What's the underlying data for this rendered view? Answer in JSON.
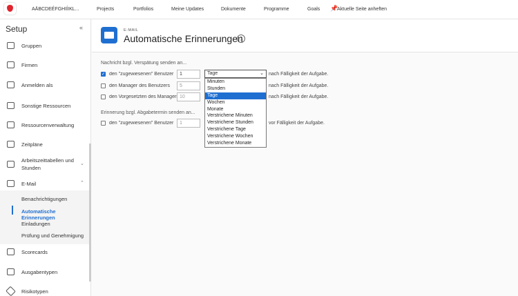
{
  "topnav": {
    "account": "AÄBCDEÉFGHIÍIKL...",
    "items": [
      "Projects",
      "Portfolios",
      "Meine Updates",
      "Dokumente",
      "Programme",
      "Goals"
    ],
    "pin": "Aktuelle Seite anheften"
  },
  "sidebar": {
    "title": "Setup",
    "collapse": "«",
    "items": [
      {
        "label": "Gruppen"
      },
      {
        "label": "Firmen"
      },
      {
        "label": "Anmelden als"
      },
      {
        "label": "Sonstige Ressourcen"
      },
      {
        "label": "Ressourcenverwaltung"
      },
      {
        "label": "Zeitpläne"
      },
      {
        "label": "Arbeitszeittabellen und Stunden"
      },
      {
        "label": "E-Mail"
      },
      {
        "label": "Scorecards"
      },
      {
        "label": "Ausgabentypen"
      },
      {
        "label": "Risikotypen"
      }
    ],
    "email_sub": [
      "Benachrichtigungen",
      "Automatische Erinnerungen",
      "Einladungen",
      "Prüfung und Genehmigung"
    ]
  },
  "header": {
    "kicker": "E-MAIL",
    "title": "Automatische Erinnerungen",
    "help": "?"
  },
  "late": {
    "label": "Nachricht bzgl. Verspätung senden an...",
    "rows": [
      {
        "text": "den \"zugewiesenen\" Benutzer",
        "value": "1",
        "checked": true,
        "after": "nach Fälligkeit der Aufgabe."
      },
      {
        "text": "den Manager des Benutzers",
        "value": "5",
        "checked": false,
        "after": "nach Fälligkeit der Aufgabe."
      },
      {
        "text": "den Vorgesetzten des Managers",
        "value": "10",
        "checked": false,
        "after": "nach Fälligkeit der Aufgabe."
      }
    ]
  },
  "due": {
    "label": "Erinnerung bzgl. Abgabetermin senden an...",
    "rows": [
      {
        "text": "den \"zugewiesenen\" Benutzer",
        "value": "1",
        "checked": false,
        "after": "vor Fälligkeit der Aufgabe."
      }
    ]
  },
  "select": {
    "value": "Tage",
    "options": [
      "Minuten",
      "Stunden",
      "Tage",
      "Wochen",
      "Monate",
      "Verstrichene Minuten",
      "Verstrichene Stunden",
      "Verstrichene Tage",
      "Verstrichene Wochen",
      "Verstrichene Monate"
    ]
  }
}
